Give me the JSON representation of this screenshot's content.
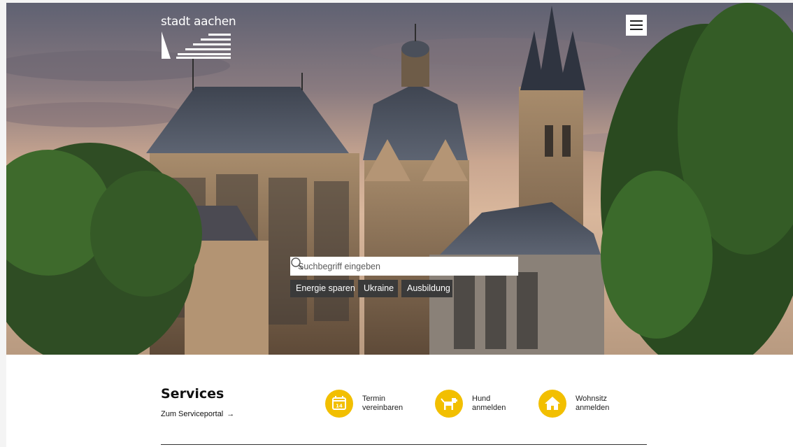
{
  "header": {
    "logo_text": "stadt aachen",
    "menu_icon": "hamburger-menu-icon"
  },
  "hero": {
    "image_description": "Aachen Cathedral at dusk",
    "search": {
      "placeholder": "Suchbegriff eingeben",
      "value": "",
      "icon": "search-icon"
    },
    "quick_links": [
      {
        "label": "Energie sparen"
      },
      {
        "label": "Ukraine"
      },
      {
        "label": "Ausbildung"
      }
    ]
  },
  "services": {
    "title": "Services",
    "portal_link": "Zum Serviceportal",
    "portal_arrow": "→",
    "items": [
      {
        "line1": "Termin",
        "line2": "vereinbaren",
        "icon": "calendar-icon"
      },
      {
        "line1": "Hund",
        "line2": "anmelden",
        "icon": "dog-icon"
      },
      {
        "line1": "Wohnsitz",
        "line2": "anmelden",
        "icon": "house-icon"
      }
    ]
  },
  "colors": {
    "accent_yellow": "#f2bf00",
    "chip_background": "#3a3a3a",
    "text_dark": "#111111"
  }
}
